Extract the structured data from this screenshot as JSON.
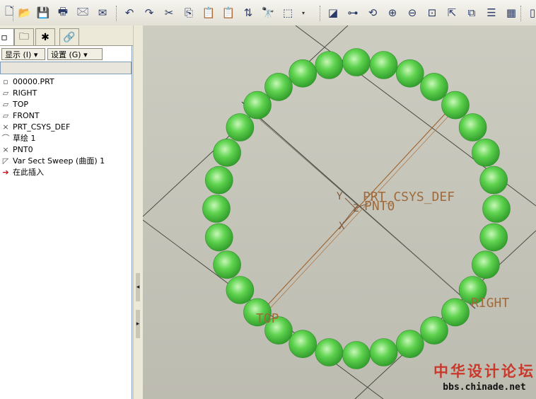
{
  "toolbar": {
    "buttons": [
      {
        "name": "new-file-icon",
        "glyph": "🗋"
      },
      {
        "name": "open-file-icon",
        "glyph": "📂"
      },
      {
        "name": "save-icon",
        "glyph": "💾"
      },
      {
        "name": "print-icon",
        "glyph": "🖶"
      },
      {
        "name": "send-mail-icon",
        "glyph": "🖂"
      },
      {
        "name": "mail-attachment-icon",
        "glyph": "✉"
      },
      {
        "name": "undo-icon",
        "glyph": "↶"
      },
      {
        "name": "redo-icon",
        "glyph": "↷"
      },
      {
        "name": "cut-icon",
        "glyph": "✂"
      },
      {
        "name": "copy-icon",
        "glyph": "⎘"
      },
      {
        "name": "paste-icon",
        "glyph": "📋"
      },
      {
        "name": "paste-special-icon",
        "glyph": "📋"
      },
      {
        "name": "regenerate-icon",
        "glyph": "⇅"
      },
      {
        "name": "find-icon",
        "glyph": "🔭"
      },
      {
        "name": "select-box-icon",
        "glyph": "⬚"
      },
      {
        "name": "select-dropdown-icon",
        "glyph": "▾"
      },
      {
        "name": "repaint-icon",
        "glyph": "◪"
      },
      {
        "name": "spin-center-icon",
        "glyph": "⊶"
      },
      {
        "name": "orient-mode-icon",
        "glyph": "⟲"
      },
      {
        "name": "zoom-in-icon",
        "glyph": "⊕"
      },
      {
        "name": "zoom-out-icon",
        "glyph": "⊖"
      },
      {
        "name": "refit-icon",
        "glyph": "⊡"
      },
      {
        "name": "reorient-icon",
        "glyph": "⇱"
      },
      {
        "name": "saved-views-icon",
        "glyph": "⧉"
      },
      {
        "name": "layers-icon",
        "glyph": "☰"
      },
      {
        "name": "view-manager-icon",
        "glyph": "▦"
      },
      {
        "name": "more-icon",
        "glyph": "▯"
      }
    ]
  },
  "left_panel": {
    "tabs": [
      {
        "name": "tab-model-tree",
        "glyph": "▫"
      },
      {
        "name": "tab-folder-browser",
        "glyph": "🗀"
      },
      {
        "name": "tab-favorites",
        "glyph": "✱"
      },
      {
        "name": "tab-connections",
        "glyph": "🔗"
      }
    ],
    "show_menu": "显示 (I) ▾",
    "settings_menu": "设置 (G) ▾",
    "tree": [
      {
        "icon": "▫",
        "label": "00000.PRT",
        "name": "model-root-icon"
      },
      {
        "icon": "▱",
        "label": "RIGHT",
        "name": "datum-plane-icon"
      },
      {
        "icon": "▱",
        "label": "TOP",
        "name": "datum-plane-icon"
      },
      {
        "icon": "▱",
        "label": "FRONT",
        "name": "datum-plane-icon"
      },
      {
        "icon": "⨯",
        "label": "PRT_CSYS_DEF",
        "name": "csys-icon"
      },
      {
        "icon": "⌒",
        "label": "草绘 1",
        "name": "sketch-icon"
      },
      {
        "icon": "×",
        "label": "PNT0",
        "name": "datum-point-icon"
      },
      {
        "icon": "◸",
        "label": "Var Sect Sweep (曲面) 1",
        "name": "sweep-surface-icon"
      },
      {
        "icon": "➔",
        "label": "在此插入",
        "name": "insert-here-icon"
      }
    ]
  },
  "viewport": {
    "labels": {
      "csys": "PRT_CSYS_DEF",
      "point": "PNT0",
      "axis_y": "Y",
      "axis_z": "Z",
      "axis_x": "X",
      "top": "TOP",
      "right": "RIGHT"
    },
    "colors": {
      "sphere": "#5fd34f",
      "sphere_highlight": "#c8f7b8",
      "datum_line": "#a0602a",
      "edge_line": "#4a4a44"
    },
    "sphere_count": 32
  },
  "watermark": {
    "line1": "中华设计论坛",
    "line2": "bbs.chinade.net"
  }
}
